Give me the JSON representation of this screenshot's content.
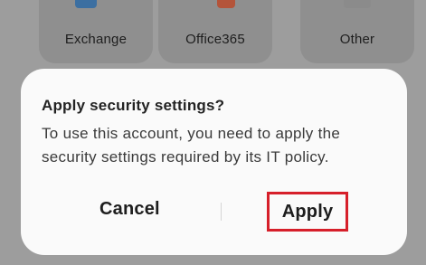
{
  "accounts": {
    "tiles": [
      {
        "label": "Exchange",
        "icon": "exchange-icon",
        "color": "#3c6fa1"
      },
      {
        "label": "Office365",
        "icon": "office365-icon",
        "color": "#b4543a"
      },
      {
        "label": "Other",
        "icon": "other-mail-icon",
        "color": "#8b8b8b"
      }
    ]
  },
  "dialog": {
    "title": "Apply security settings?",
    "body": "To use this account, you need to apply the security settings required by its IT policy.",
    "cancel_label": "Cancel",
    "apply_label": "Apply",
    "highlight_color": "#d61f2a"
  }
}
